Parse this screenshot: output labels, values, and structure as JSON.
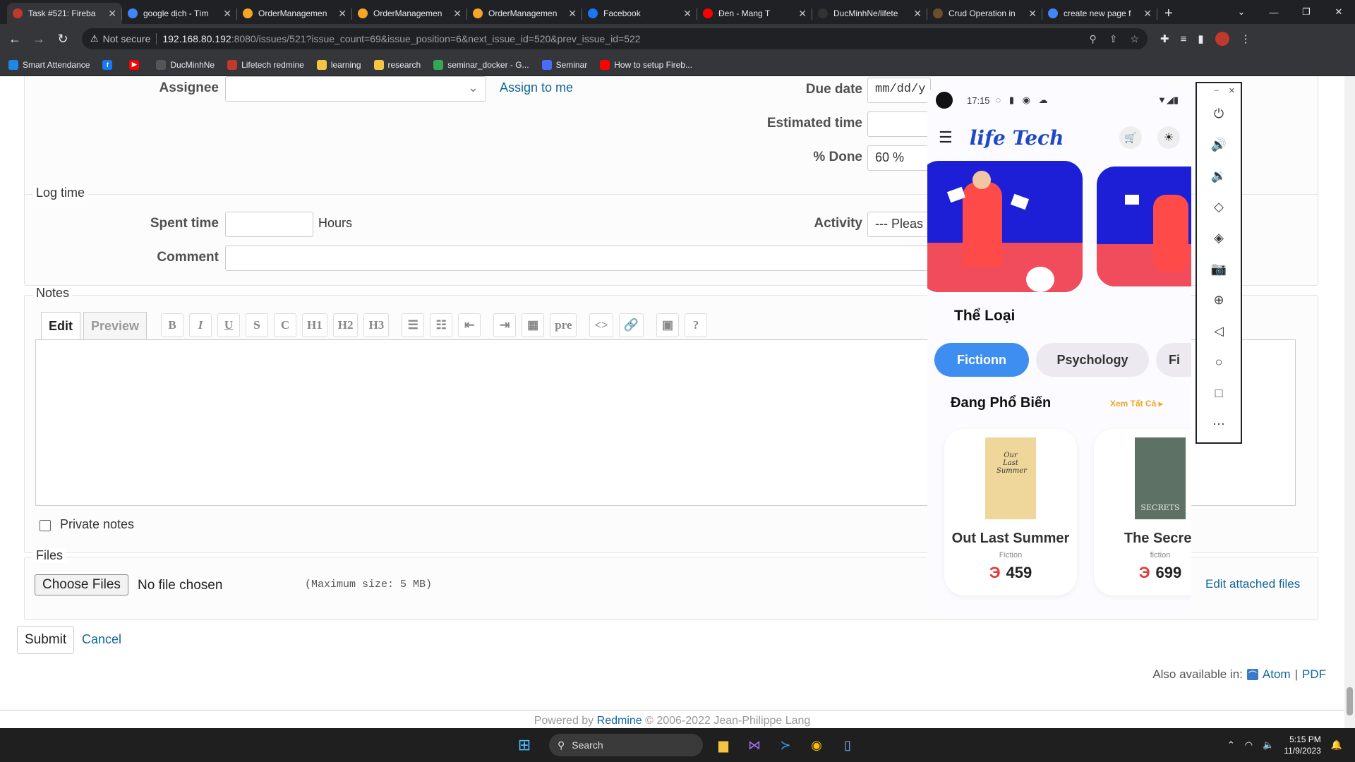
{
  "browser": {
    "tabs": [
      {
        "title": "Task #521: Fireba",
        "color": "#c0392b"
      },
      {
        "title": "google dịch - Tìm",
        "color": "#4285f4"
      },
      {
        "title": "OrderManagemen",
        "color": "#f5a623"
      },
      {
        "title": "OrderManagemen",
        "color": "#f5a623"
      },
      {
        "title": "OrderManagemen",
        "color": "#f5a623"
      },
      {
        "title": "Facebook",
        "color": "#1877f2"
      },
      {
        "title": "Đen - Mang T",
        "color": "#ff0000"
      },
      {
        "title": "DucMinhNe/lifete",
        "color": "#333333"
      },
      {
        "title": "Crud Operation in",
        "color": "#6b4f2a"
      },
      {
        "title": "create new page f",
        "color": "#4285f4"
      }
    ],
    "not_secure": "Not secure",
    "url_host": "192.168.80.192",
    "url_path": ":8080/issues/521?issue_count=69&issue_position=6&next_issue_id=520&prev_issue_id=522",
    "bookmarks": [
      {
        "label": "Smart Attendance",
        "color": "#1e88e5"
      },
      {
        "label": "",
        "color": "#1877f2",
        "icon": "f"
      },
      {
        "label": "",
        "color": "#ff0000",
        "icon": "▶"
      },
      {
        "label": "DucMinhNe",
        "color": "#555555"
      },
      {
        "label": "Lifetech redmine",
        "color": "#c0392b"
      },
      {
        "label": "learning",
        "color": "#f4c542"
      },
      {
        "label": "research",
        "color": "#f4c542"
      },
      {
        "label": "seminar_docker - G...",
        "color": "#34a853"
      },
      {
        "label": "Seminar",
        "color": "#4a6cf7"
      },
      {
        "label": "How to setup Fireb...",
        "color": "#ff0000"
      }
    ]
  },
  "form": {
    "assignee_label": "Assignee",
    "assign_to_me": "Assign to me",
    "due_date_label": "Due date",
    "due_date_placeholder": "mm/dd/y",
    "estimated_label": "Estimated time",
    "done_label": "% Done",
    "done_value": "60 %",
    "log_time_legend": "Log time",
    "spent_label": "Spent time",
    "hours": "Hours",
    "activity_label": "Activity",
    "activity_value": "--- Pleas",
    "comment_label": "Comment",
    "notes_legend": "Notes",
    "tab_edit": "Edit",
    "tab_preview": "Preview",
    "toolbar": [
      "B",
      "I",
      "U",
      "S",
      "C",
      "H1",
      "H2",
      "H3",
      "☰",
      "☷",
      "⇤",
      "⇥",
      "▦",
      "pre",
      "<>",
      "🔗",
      "▣",
      "?"
    ],
    "private_notes": "Private notes",
    "files_legend": "Files",
    "choose_files": "Choose Files",
    "no_file": "No file chosen",
    "max_size": "(Maximum size: 5 MB)",
    "edit_attached": "Edit attached files",
    "submit": "Submit",
    "cancel": "Cancel",
    "also_available": "Also available in:",
    "atom": "Atom",
    "pdf": "PDF",
    "powered_by": "Powered by",
    "redmine": "Redmine",
    "copyright": "© 2006-2022 Jean-Philippe Lang"
  },
  "phone": {
    "time": "17:15",
    "brand": "life Tech",
    "category_title": "Thể Loại",
    "categories": [
      "Fictionn",
      "Psychology",
      "Fi"
    ],
    "popular_title": "Đang Phổ Biến",
    "see_all": "Xem Tất Cả ▸",
    "books": [
      {
        "title": "Out Last Summer",
        "genre": "Fiction",
        "currency": "Э",
        "price": "459",
        "cover_text": "Our Last Summer"
      },
      {
        "title": "The Secret",
        "genre": "fiction",
        "currency": "Э",
        "price": "699",
        "cover_text": "SECRETS"
      }
    ],
    "accent": "#3d8ef0",
    "banner_color": "#1d1fd6"
  },
  "taskbar": {
    "search": "Search",
    "time": "5:15 PM",
    "date": "11/9/2023"
  }
}
